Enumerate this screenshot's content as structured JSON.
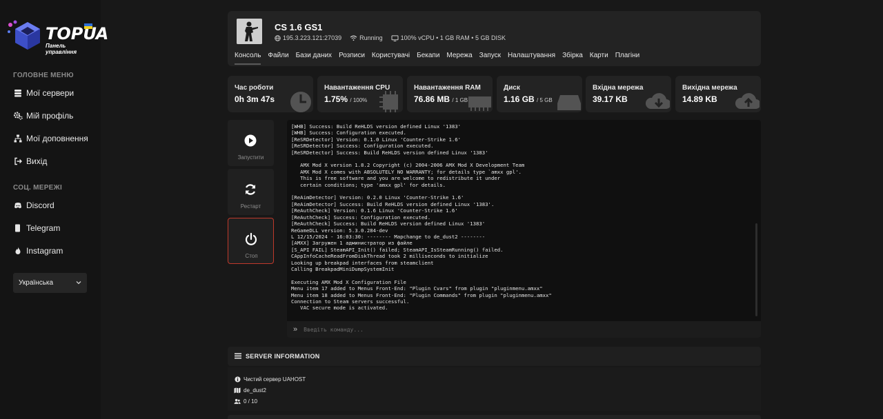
{
  "brand": {
    "name": "TOPUA",
    "subtitle": "Панель управління"
  },
  "sidebar": {
    "main_heading": "ГОЛОВНЕ МЕНЮ",
    "main_items": [
      {
        "label": "Мої сервери",
        "icon": "server-icon"
      },
      {
        "label": "Мій профіль",
        "icon": "gears-icon"
      },
      {
        "label": "Мої доповнення",
        "icon": "sitemap-icon"
      },
      {
        "label": "Вихід",
        "icon": "sign-out-icon"
      }
    ],
    "social_heading": "СОЦ. МЕРЕЖІ",
    "social_items": [
      {
        "label": "Discord",
        "icon": "discord-icon"
      },
      {
        "label": "Telegram",
        "icon": "telegram-icon"
      },
      {
        "label": "Instagram",
        "icon": "instagram-icon"
      }
    ],
    "language": "Українська"
  },
  "server": {
    "name": "CS 1.6 GS1",
    "address": "195.3.223.121:27039",
    "status": "Running",
    "resources": "100% vCPU • 1 GB RAM • 5 GB DISK",
    "tabs": [
      "Консоль",
      "Файли",
      "Бази даних",
      "Розписи",
      "Користувачі",
      "Бекапи",
      "Мережа",
      "Запуск",
      "Налаштування",
      "Збірка",
      "Карти",
      "Плагіни"
    ],
    "active_tab": "Консоль"
  },
  "stats": [
    {
      "label": "Час роботи",
      "value": "0h 3m 47s",
      "limit": "",
      "icon": "clock-icon"
    },
    {
      "label": "Навантаження CPU",
      "value": "1.75%",
      "limit": "/ 100%",
      "icon": "cpu-icon"
    },
    {
      "label": "Навантаження RAM",
      "value": "76.86 MB",
      "limit": "/ 1 GB",
      "icon": "memory-icon"
    },
    {
      "label": "Диск",
      "value": "1.16 GB",
      "limit": "/ 5 GB",
      "icon": "hdd-icon"
    },
    {
      "label": "Вхідна мережа",
      "value": "39.17 KB",
      "limit": "",
      "icon": "cloud-download-icon"
    },
    {
      "label": "Вихідна мережа",
      "value": "14.89 KB",
      "limit": "",
      "icon": "cloud-upload-icon"
    }
  ],
  "controls": {
    "start": "Запустити",
    "restart": "Рестарт",
    "stop": "Стоп"
  },
  "console": {
    "lines": [
      "[WHB] Success: Build ReHLDS version defined Linux '1383'",
      "[WHB] Success: Configuration executed.",
      "[ReSRDetector] Version: 0.1.0 Linux 'Counter-Strike 1.6'",
      "[ReSRDetector] Success: Configuration executed.",
      "[ReSRDetector] Success: Build ReHLDS version defined Linux '1383'",
      "",
      "   AMX Mod X version 1.8.2 Copyright (c) 2004-2006 AMX Mod X Development Team",
      "   AMX Mod X comes with ABSOLUTELY NO WARRANTY; for details type `amxx gpl'.",
      "   This is free software and you are welcome to redistribute it under",
      "   certain conditions; type 'amxx gpl' for details.",
      "",
      "[ReAimDetector] Version: 0.2.0 Linux 'Counter-Strike 1.6'",
      "[ReAimDetector] Success: Build ReHLDS version defined Linux '1383'.",
      "[ReAuthCheck] Version: 0.1.6 Linux 'Counter-Strike 1.6'",
      "[ReAuthCheck] Success: Configuration executed.",
      "[ReAuthCheck] Success: Build ReHLDS version defined Linux '1383'",
      "ReGameDLL version: 5.3.0.284-dev",
      "L 12/15/2024 - 16:03:30: -------- Mapchange to de_dust2 --------",
      "[AMXX] Загружен 1 администратор из файле",
      "[S_API FAIL] SteamAPI_Init() failed; SteamAPI_IsSteamRunning() failed.",
      "CAppInfoCacheReadFromDiskThread took 2 milliseconds to initialize",
      "Looking up breakpad interfaces from steamclient",
      "Calling BreakpadMiniDumpSystemInit",
      "",
      "Executing AMX Mod X Configuration File",
      "Menu item 17 added to Menus Front-End: \"Plugin Cvars\" from plugin \"pluginmenu.amxx\"",
      "Menu item 18 added to Menus Front-End: \"Plugin Commands\" from plugin \"pluginmenu.amxx\"",
      "Connection to Steam servers successful.",
      "   VAC secure mode is activated."
    ],
    "placeholder": "Введіть команду..."
  },
  "server_info": {
    "heading": "SERVER INFORMATION",
    "description": "Чистий сервер UAHOST",
    "map": "de_dust2",
    "players": "0  / 10"
  },
  "colors": {
    "background": "#181818",
    "card": "#232323",
    "stop_border": "#c0392b"
  }
}
